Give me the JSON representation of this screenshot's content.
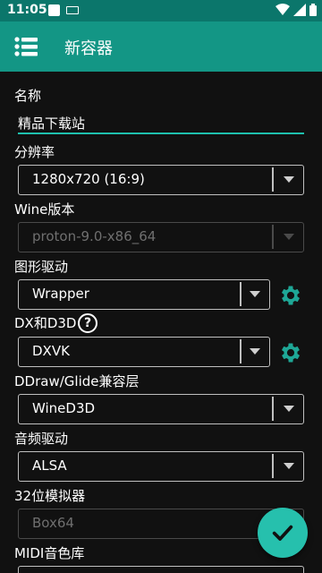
{
  "status_bar": {
    "time": "11:05"
  },
  "app_bar": {
    "title": "新容器",
    "menu_icon": "menu-icon"
  },
  "colors": {
    "status_bar": "#0b766b",
    "app_bar": "#139685",
    "accent": "#26c0ad",
    "background": "#111111"
  },
  "form": {
    "name_label": "名称",
    "name_value": "精品下载站",
    "resolution_label": "分辨率",
    "resolution_value": "1280x720 (16:9)",
    "wine_label": "Wine版本",
    "wine_value": "proton-9.0-x86_64",
    "graphics_label": "图形驱动",
    "graphics_value": "Wrapper",
    "dxd3d_label": "DX和D3D",
    "dxd3d_value": "DXVK",
    "ddraw_label": "DDraw/Glide兼容层",
    "ddraw_value": "WineD3D",
    "audio_label": "音频驱动",
    "audio_value": "ALSA",
    "emulator_label": "32位模拟器",
    "emulator_value": "Box64",
    "midi_label": "MIDI音色库",
    "help_glyph": "?"
  },
  "fab": {
    "icon": "check-icon"
  }
}
